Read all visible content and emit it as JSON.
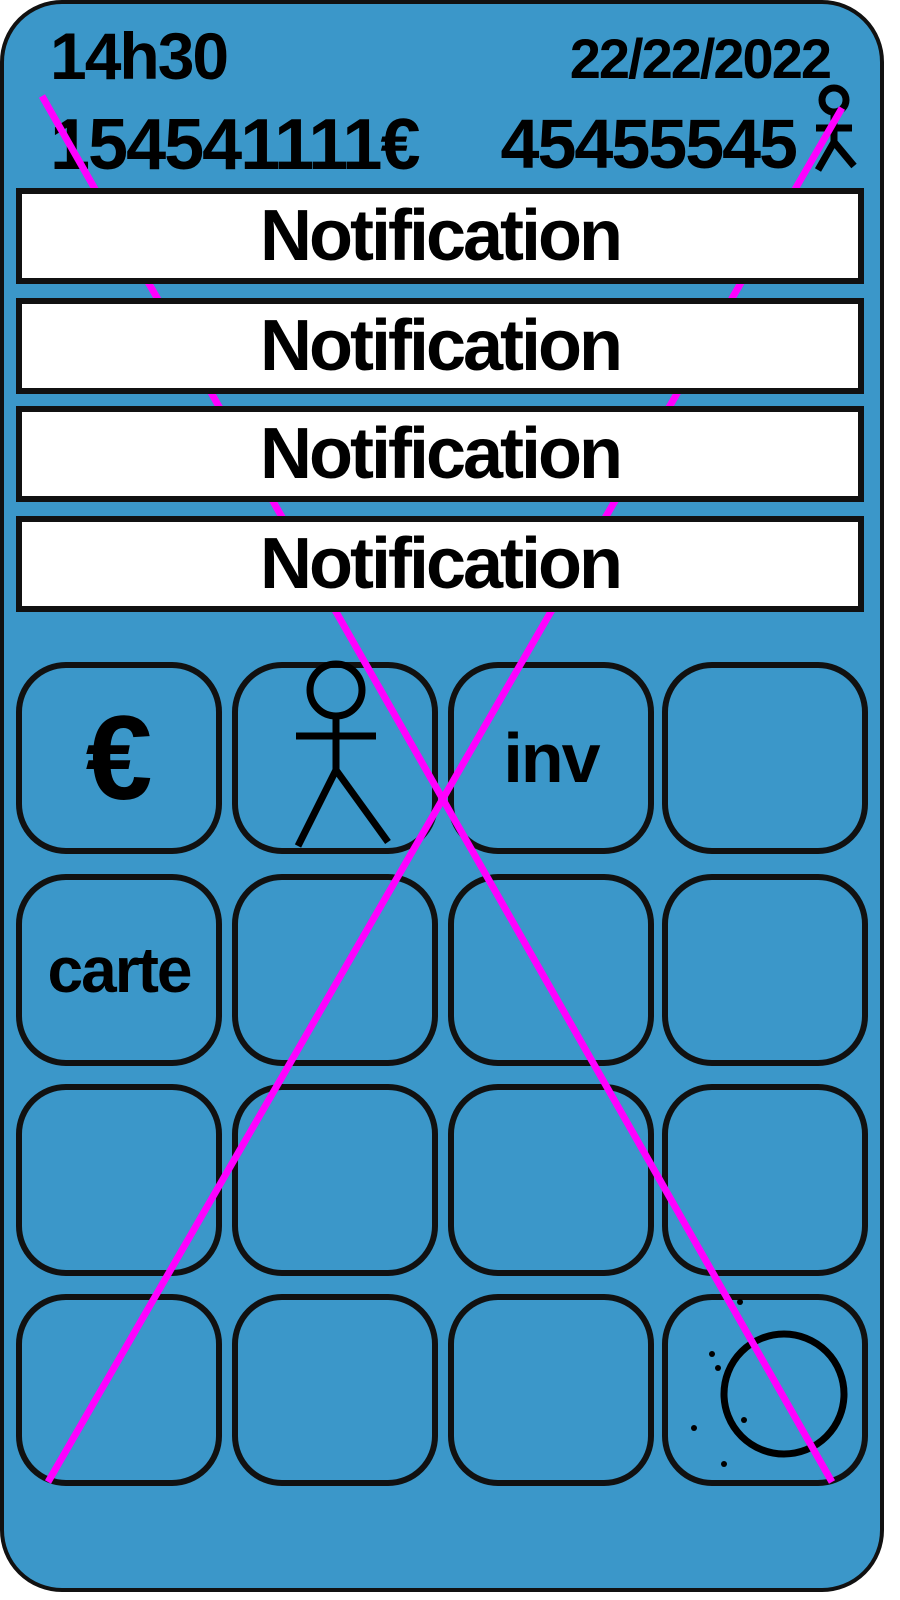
{
  "status": {
    "time": "14h30",
    "date": "22/22/2022",
    "money": "154541111€",
    "population": "45455545"
  },
  "notifications": [
    {
      "label": "Notification"
    },
    {
      "label": "Notification"
    },
    {
      "label": "Notification"
    },
    {
      "label": "Notification"
    }
  ],
  "apps": {
    "euro_label": "€",
    "inv_label": "inv",
    "carte_label": "carte"
  },
  "colors": {
    "background": "#3b97c9",
    "outline": "#111111",
    "cross_lines": "#ff00ff",
    "notification_bg": "#ffffff"
  },
  "icons": [
    "person-icon",
    "person-icon-large",
    "circle-icon"
  ]
}
